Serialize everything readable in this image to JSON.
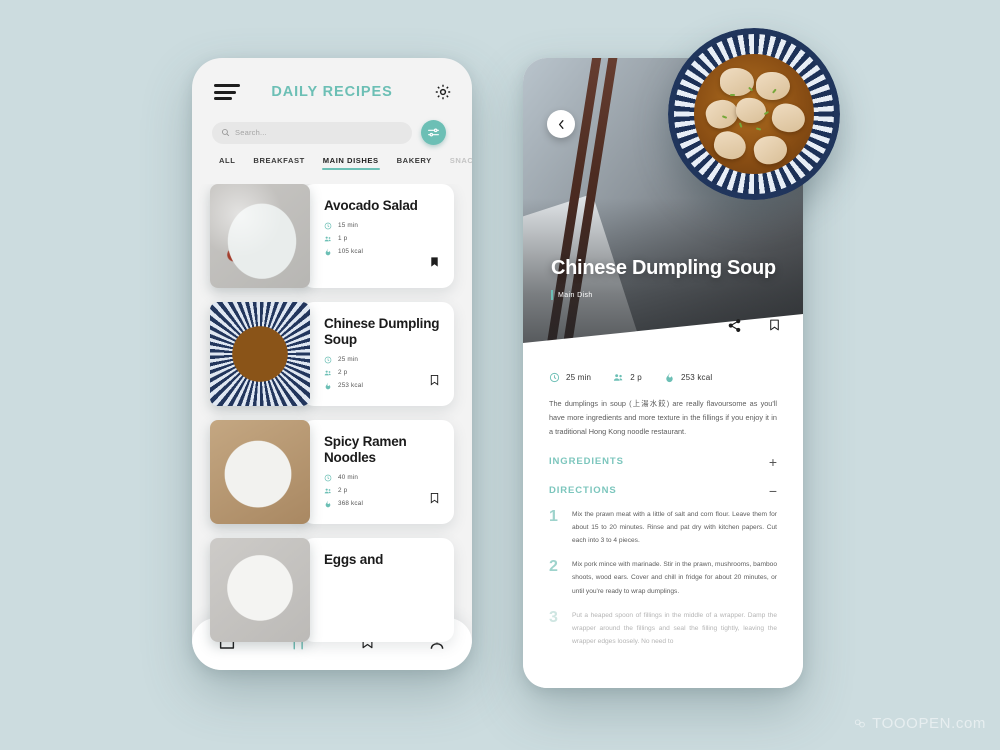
{
  "background_color": "#ccdcdf",
  "accent_color": "#6cbfb5",
  "list_screen": {
    "header": {
      "menu_icon": "hamburger-menu-icon",
      "title": "DAILY RECIPES",
      "settings_icon": "gear-icon"
    },
    "search": {
      "placeholder": "Search...",
      "value": "",
      "search_icon": "magnifier-icon",
      "filter_icon": "sliders-icon"
    },
    "tabs": [
      {
        "label": "ALL",
        "active": false,
        "dim": false
      },
      {
        "label": "BREAKFAST",
        "active": false,
        "dim": false
      },
      {
        "label": "MAIN DISHES",
        "active": true,
        "dim": false
      },
      {
        "label": "BAKERY",
        "active": false,
        "dim": false
      },
      {
        "label": "SNAC",
        "active": false,
        "dim": true
      }
    ],
    "recipes": [
      {
        "title": "Avocado Salad",
        "time": "15 min",
        "servings": "1 p",
        "calories": "105 kcal",
        "bookmarked": true
      },
      {
        "title": "Chinese Dumpling Soup",
        "time": "25 min",
        "servings": "2 p",
        "calories": "253 kcal",
        "bookmarked": false
      },
      {
        "title": "Spicy Ramen Noodles",
        "time": "40 min",
        "servings": "2 p",
        "calories": "368 kcal",
        "bookmarked": false
      },
      {
        "title": "Eggs and",
        "time": "",
        "servings": "",
        "calories": "",
        "bookmarked": false
      }
    ],
    "bottom_nav": [
      {
        "icon": "home-icon",
        "active": false
      },
      {
        "icon": "fork-knife-icon",
        "active": true
      },
      {
        "icon": "bookmark-icon",
        "active": false
      },
      {
        "icon": "person-icon",
        "active": false
      }
    ]
  },
  "detail_screen": {
    "back_icon": "chevron-left-icon",
    "title": "Chinese Dumpling Soup",
    "category": "Main Dish",
    "share_icon": "share-icon",
    "bookmark_icon": "bookmark-icon",
    "stats": {
      "time": "25 min",
      "servings": "2 p",
      "calories": "253 kcal"
    },
    "description": "The dumplings in soup (上湯水餃) are really flavoursome as you'll have more ingredients and more texture in the fillings if you enjoy it in a traditional Hong Kong noodle restaurant.",
    "sections": [
      {
        "label": "INGREDIENTS",
        "toggle": "+",
        "expanded": false
      },
      {
        "label": "DIRECTIONS",
        "toggle": "−",
        "expanded": true
      }
    ],
    "directions": [
      {
        "number": "1",
        "text": "Mix the prawn meat with a little of salt and corn flour. Leave them for about 15 to 20 minutes. Rinse and pat dry with kitchen papers. Cut each into 3 to 4 pieces."
      },
      {
        "number": "2",
        "text": "Mix pork mince with marinade. Stir in the prawn, mushrooms, bamboo shoots, wood ears. Cover and chill in fridge for about 20 minutes, or until you're ready to wrap dumplings."
      },
      {
        "number": "3",
        "text": "Put a heaped spoon of fillings in the middle of a wrapper. Damp the wrapper around the fillings and seal the filling tightly, leaving the wrapper edges loosely. No need to"
      }
    ]
  },
  "watermark": {
    "text": "TOOOPEN.com",
    "icon": "tooopen-logo-icon"
  }
}
